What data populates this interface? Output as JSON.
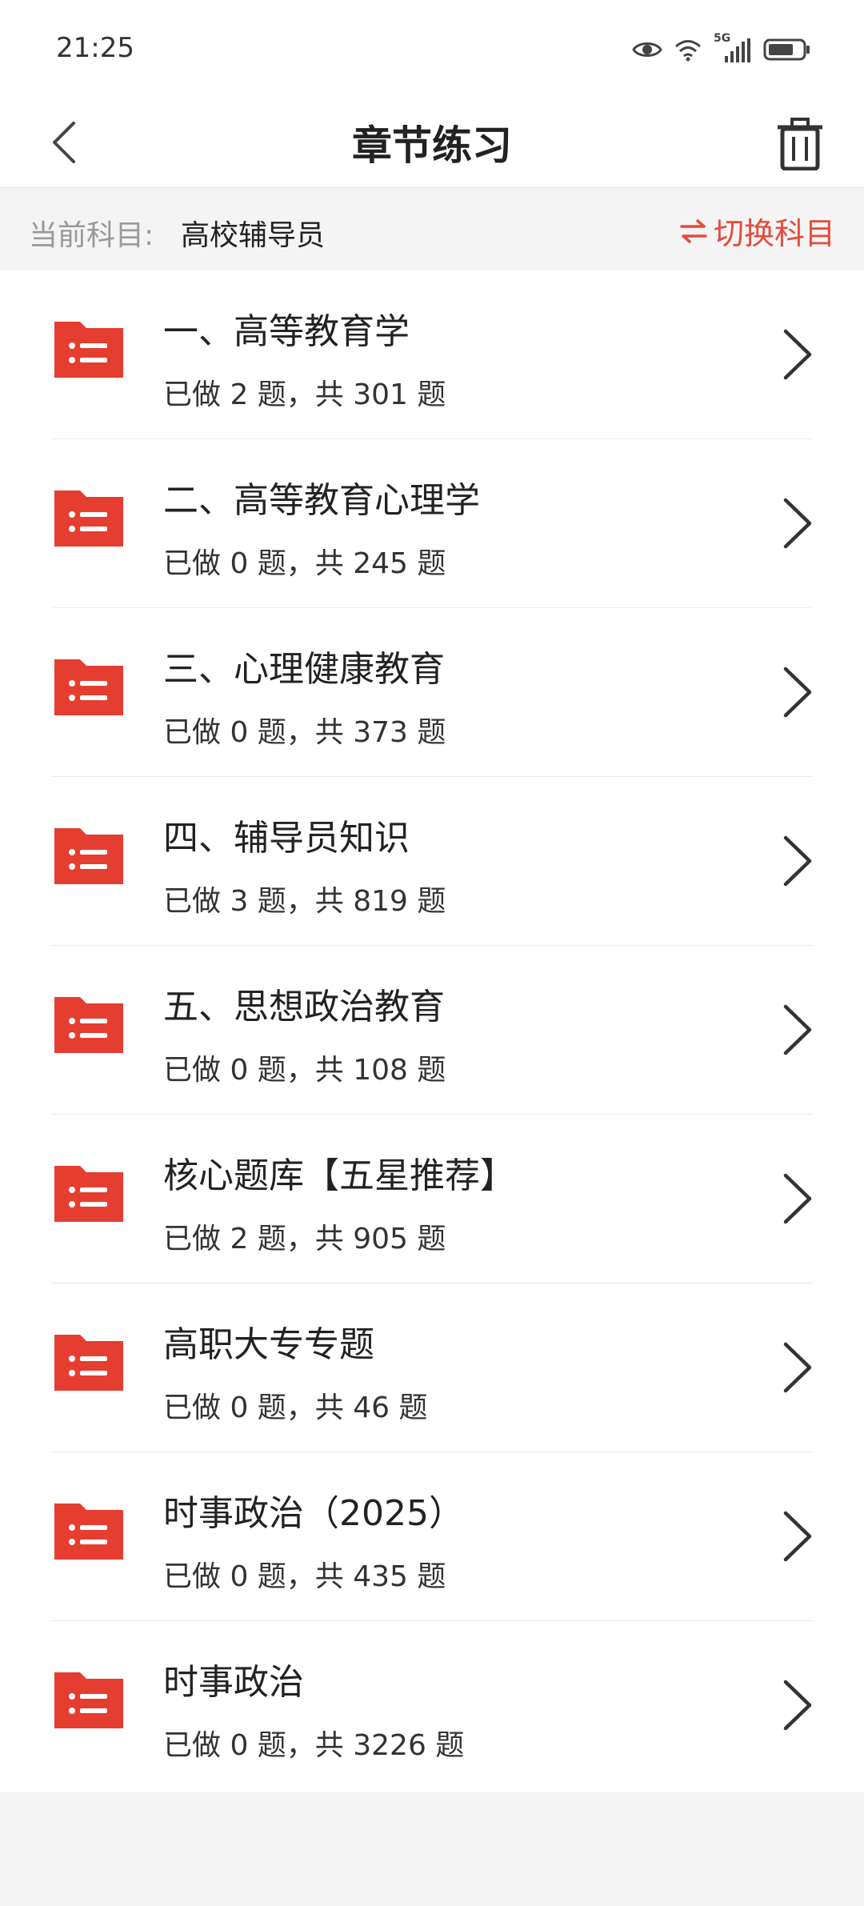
{
  "status_bar": {
    "time": "21:25",
    "network_label": "5G"
  },
  "header": {
    "title": "章节练习"
  },
  "subject_bar": {
    "label": "当前科目:",
    "value": "高校辅导员",
    "switch_label": "切换科目"
  },
  "colors": {
    "accent": "#e54b3a",
    "icon_red": "#e53d30"
  },
  "chapters": [
    {
      "title": "一、高等教育学",
      "progress": "已做 2 题，共 301 题"
    },
    {
      "title": "二、高等教育心理学",
      "progress": "已做 0 题，共 245 题"
    },
    {
      "title": "三、心理健康教育",
      "progress": "已做 0 题，共 373 题"
    },
    {
      "title": "四、辅导员知识",
      "progress": "已做 3 题，共 819 题"
    },
    {
      "title": "五、思想政治教育",
      "progress": "已做 0 题，共 108 题"
    },
    {
      "title": "核心题库【五星推荐】",
      "progress": "已做 2 题，共 905 题"
    },
    {
      "title": "高职大专专题",
      "progress": "已做 0 题，共 46 题"
    },
    {
      "title": "时事政治（2025）",
      "progress": "已做 0 题，共 435 题"
    },
    {
      "title": "时事政治",
      "progress": "已做 0 题，共 3226 题"
    }
  ]
}
